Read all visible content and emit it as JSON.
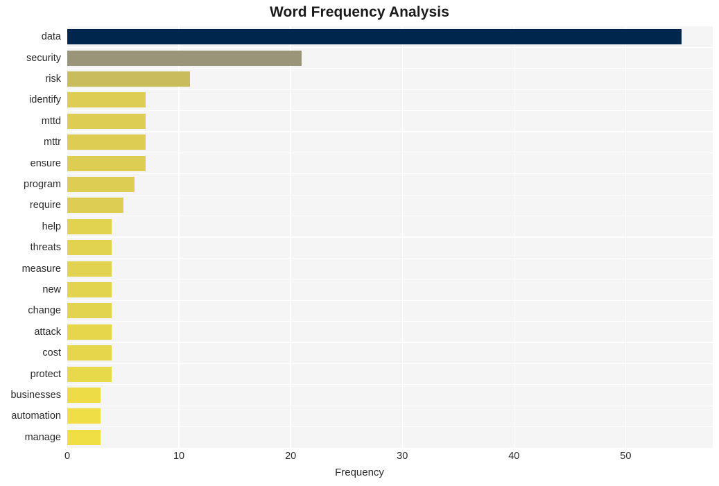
{
  "chart_data": {
    "type": "bar",
    "orientation": "horizontal",
    "title": "Word Frequency Analysis",
    "xlabel": "Frequency",
    "ylabel": "",
    "categories": [
      "data",
      "security",
      "risk",
      "identify",
      "mttd",
      "mttr",
      "ensure",
      "program",
      "require",
      "help",
      "threats",
      "measure",
      "new",
      "change",
      "attack",
      "cost",
      "protect",
      "businesses",
      "automation",
      "manage"
    ],
    "values": [
      55,
      21,
      11,
      7,
      7,
      7,
      7,
      6,
      5,
      4,
      4,
      4,
      4,
      4,
      4,
      4,
      4,
      3,
      3,
      3
    ],
    "xlim": [
      0,
      57.8
    ],
    "xticks": [
      0,
      10,
      20,
      30,
      40,
      50
    ],
    "xtick_labels": [
      "0",
      "10",
      "20",
      "30",
      "40",
      "50"
    ],
    "grid": true,
    "grid_color": "#ffffff",
    "legend": "none",
    "plot_background": "#f5f5f5",
    "figure_background": "#ffffff",
    "bar_colors": [
      "#00264d",
      "#9a9478",
      "#c9bc5c",
      "#ddcd53",
      "#ddcd53",
      "#ddcd53",
      "#ddcd53",
      "#ddcd53",
      "#ddcd53",
      "#e1d24f",
      "#e1d24f",
      "#e1d24f",
      "#e3d44d",
      "#e3d44d",
      "#e5d64b",
      "#e5d64b",
      "#e7d949",
      "#eddc46",
      "#efde45",
      "#f0df44"
    ]
  }
}
